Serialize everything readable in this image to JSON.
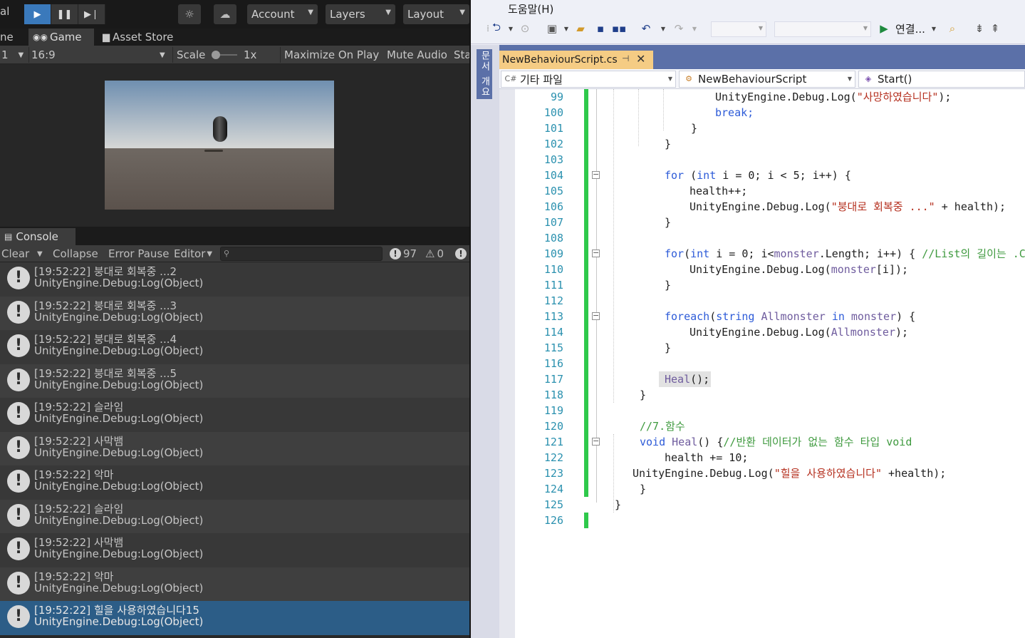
{
  "unity": {
    "toolbar": {
      "left_text": "al",
      "account_label": "Account",
      "layers_label": "Layers",
      "layout_label": "Layout"
    },
    "tabs": {
      "partial": "ne",
      "game": "Game",
      "asset_store": "Asset Store"
    },
    "gamebar": {
      "display": "1",
      "aspect": "16:9",
      "scale_label": "Scale",
      "scale_value": "1x",
      "maximize": "Maximize On Play",
      "mute": "Mute Audio",
      "stats": "Sta"
    },
    "console": {
      "tab": "Console",
      "clear": "Clear",
      "collapse": "Collapse",
      "error_pause": "Error Pause",
      "editor": "Editor",
      "info_count": "97",
      "warn_count": "0",
      "entries": [
        {
          "line1": "[19:52:22] 붕대로 회복중 ...2",
          "line2": "UnityEngine.Debug:Log(Object)"
        },
        {
          "line1": "[19:52:22] 붕대로 회복중 ...3",
          "line2": "UnityEngine.Debug:Log(Object)"
        },
        {
          "line1": "[19:52:22] 붕대로 회복중 ...4",
          "line2": "UnityEngine.Debug:Log(Object)"
        },
        {
          "line1": "[19:52:22] 붕대로 회복중 ...5",
          "line2": "UnityEngine.Debug:Log(Object)"
        },
        {
          "line1": "[19:52:22] 슬라임",
          "line2": "UnityEngine.Debug:Log(Object)"
        },
        {
          "line1": "[19:52:22] 사막뱀",
          "line2": "UnityEngine.Debug:Log(Object)"
        },
        {
          "line1": "[19:52:22] 악마",
          "line2": "UnityEngine.Debug:Log(Object)"
        },
        {
          "line1": "[19:52:22] 슬라임",
          "line2": "UnityEngine.Debug:Log(Object)"
        },
        {
          "line1": "[19:52:22] 사막뱀",
          "line2": "UnityEngine.Debug:Log(Object)"
        },
        {
          "line1": "[19:52:22] 악마",
          "line2": "UnityEngine.Debug:Log(Object)"
        },
        {
          "line1": "[19:52:22] 힐을 사용하였습니다15",
          "line2": "UnityEngine.Debug:Log(Object)"
        }
      ]
    }
  },
  "vs": {
    "menu_help": "도움말(H)",
    "toolbar_attach": "연결...",
    "side_tab": "문서 개요",
    "tab_title": "NewBehaviourScript.cs",
    "nav_project": "기타 파일",
    "nav_class": "NewBehaviourScript",
    "nav_member": "Start()",
    "line_numbers": [
      "99",
      "100",
      "101",
      "102",
      "103",
      "104",
      "105",
      "106",
      "107",
      "108",
      "109",
      "110",
      "111",
      "112",
      "113",
      "114",
      "115",
      "116",
      "117",
      "118",
      "119",
      "120",
      "121",
      "122",
      "123",
      "124",
      "125",
      "126"
    ],
    "code": {
      "l99a": "UnityEngine.Debug.Log(",
      "l99b": "\"사망하였습니다\"",
      "l99c": ");",
      "l100": "break;",
      "l101": "}",
      "l102": "}",
      "l104a": "for",
      "l104b": " (",
      "l104c": "int",
      "l104d": " i = 0; i < 5; i++) {",
      "l105": "health++;",
      "l106a": "UnityEngine.Debug.Log(",
      "l106b": "\"붕대로 회복중 ...\"",
      "l106c": " + health);",
      "l107": "}",
      "l109a": "for",
      "l109b": "(",
      "l109c": "int",
      "l109d": " i = 0; i<",
      "l109e": "monster",
      "l109f": ".Length; i++) {",
      "l109g": "//List의 길이는 .Count",
      "l110a": "UnityEngine.Debug.Log(",
      "l110b": "monster",
      "l110c": "[i]);",
      "l111": "}",
      "l113a": "foreach",
      "l113b": "(",
      "l113c": "string",
      "l113d": " ",
      "l113e": "Allmonster",
      "l113f": " ",
      "l113g": "in",
      "l113h": " ",
      "l113i": "monster",
      "l113j": ") {",
      "l114a": "UnityEngine.Debug.Log(",
      "l114b": "Allmonster",
      "l114c": ");",
      "l115": "}",
      "l117a": "Heal",
      "l117b": "();",
      "l118": "}",
      "l120": "//7.함수",
      "l121a": "void",
      "l121b": " ",
      "l121c": "Heal",
      "l121d": "() {",
      "l121e": "//반환 데이터가 없는 함수 타입 void",
      "l122": "health += 10;",
      "l123a": "UnityEngine.Debug.Log(",
      "l123b": "\"힐을 사용하였습니다\"",
      "l123c": " +health);",
      "l124": "}",
      "l125": "}"
    }
  }
}
